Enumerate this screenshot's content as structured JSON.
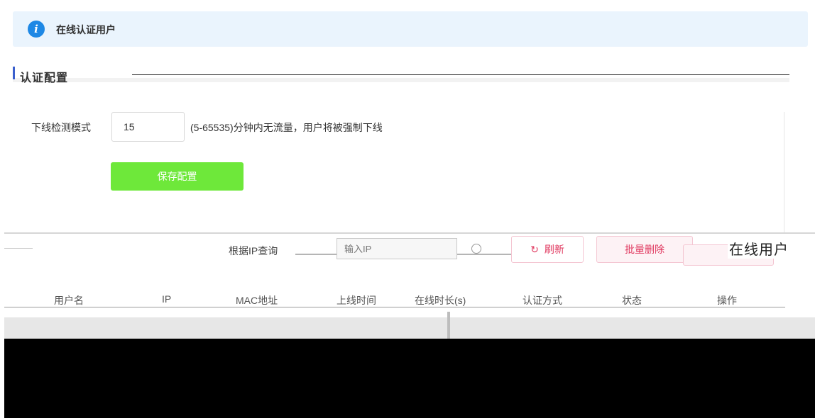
{
  "info_bar": {
    "icon": "info-icon",
    "icon_glyph": "i",
    "text": "在线认证用户"
  },
  "config_section": {
    "title": "认证配置"
  },
  "offline_detection": {
    "label": "下线检测模式",
    "value": "15",
    "hint": "(5-65535)分钟内无流量，用户将被强制下线"
  },
  "save_button": {
    "label": "保存配置"
  },
  "toolbar": {
    "search_label": "根据IP查询",
    "search_placeholder": "输入IP",
    "search_icon": "search-icon",
    "refresh_icon": "refresh-icon",
    "refresh_glyph": "↻",
    "refresh_label": "刷新",
    "batch_delete_label": "批量删除",
    "online_users_title": "在线用户"
  },
  "table": {
    "columns": [
      "用户名",
      "IP",
      "MAC地址",
      "上线时间",
      "在线时长(s)",
      "认证方式",
      "状态",
      "操作"
    ]
  },
  "colors": {
    "accent": "#1e88e5",
    "save_button": "#6ee83a",
    "danger": "#e0385f",
    "info_bg": "#eaf4fd"
  }
}
